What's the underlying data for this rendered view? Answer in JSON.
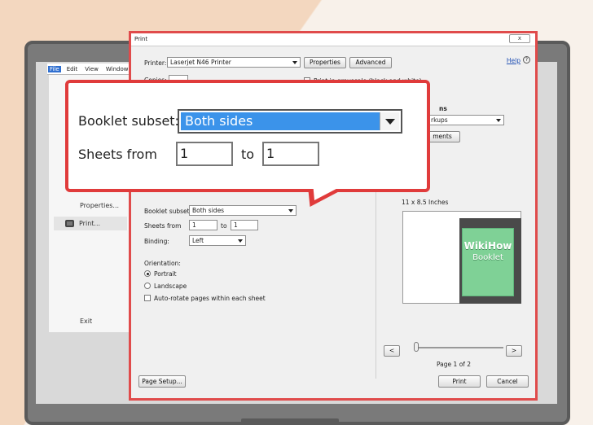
{
  "app_menu": {
    "file": "File",
    "edit": "Edit",
    "view": "View",
    "window": "Window"
  },
  "file_menu": {
    "properties": "Properties...",
    "print": "Print...",
    "exit": "Exit"
  },
  "dialog": {
    "title": "Print",
    "close_label": "x",
    "printer_label": "Printer:",
    "printer_value": "Laserjet N46 Printer",
    "properties_button": "Properties",
    "advanced_button": "Advanced",
    "help_link": "Help",
    "help_icon": "?",
    "copies_label": "Copies:",
    "grayscale_label": "Print in grayscale (black and white)",
    "comments_heading_fragment": "ns",
    "comments_select_fragment": "rkups",
    "summarize_button_fragment": "ments",
    "booklet_subset_label": "Booklet subset:",
    "booklet_subset_value": "Both sides",
    "sheets_from_label": "Sheets from",
    "sheets_from_value": "1",
    "sheets_to_label": "to",
    "sheets_to_value": "1",
    "binding_label": "Binding:",
    "binding_value": "Left",
    "orientation_label": "Orientation:",
    "portrait_label": "Portrait",
    "landscape_label": "Landscape",
    "autorotate_label": "Auto-rotate pages within each sheet",
    "paper_size": "11 x 8.5 Inches",
    "preview_title": "WikiHow",
    "preview_subtitle": "Booklet",
    "prev_button": "<",
    "next_button": ">",
    "page_indicator": "Page 1 of 2",
    "page_setup_button": "Page Setup...",
    "print_button": "Print",
    "cancel_button": "Cancel"
  },
  "callout": {
    "booklet_subset_label": "Booklet subset:",
    "booklet_subset_value": "Both sides",
    "sheets_from_label": "Sheets from",
    "sheets_from_value": "1",
    "sheets_to_label": "to",
    "sheets_to_value": "1"
  },
  "colors": {
    "highlight": "#3b93ea",
    "callout_border": "#e03b3b",
    "dialog_border": "#e04b4b",
    "preview_book": "#7fd196"
  }
}
